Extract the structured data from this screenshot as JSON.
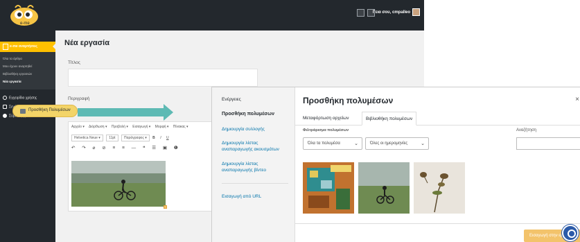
{
  "header": {
    "user_text": "Γεια σου, cmpalleo",
    "buttons": [
      "expand",
      "minimize"
    ]
  },
  "sidebar": {
    "active_section": "e-me αναρτήσεις",
    "sub_items": [
      "Όλα τα άρθρα",
      "Μου έχουν αναρτηθεί",
      "Βιβλιοθήκη εργασιών",
      "Νέα εργασία"
    ],
    "items": [
      "Εγχειρίδιο χρήσης",
      "Σενάρια χρήσης",
      "Σύμπτυξη μενού"
    ]
  },
  "editor": {
    "page_title": "Νέα εργασία",
    "title_label": "Τίτλος",
    "description_label": "Περιγραφή",
    "add_media_label": "Προσθήκη Πολυμέσων",
    "menubar": [
      "Αρχείο ▾",
      "Διόρθωση ▾",
      "Προβολή ▾",
      "Εισαγωγή ▾",
      "Μορφή ▾",
      "Πίνακας ▾"
    ],
    "font_family": "Helvetica Neue ▾",
    "font_size": "11pt",
    "paragraph": "Παράγραφος ▾",
    "bold": "B",
    "italic": "I",
    "underline": "U",
    "toolbar2": "↶ ↷ ⌀ ⊘ ≡ ≡ — ❝ ☰ ▣ ❶"
  },
  "media_modal": {
    "menu_heading": "Ενέργειες",
    "menu_current": "Προσθήκη πολυμέσων",
    "menu_links": [
      "Δημιουργία συλλογής",
      "Δημιουργία λίστας αναπαραγωγής ακουσμάτων",
      "Δημιουργία λίστας αναπαραγωγής βίντεο",
      "Εισαγωγή από URL"
    ],
    "title": "Προσθήκη πολυμέσων",
    "close": "×",
    "tabs": [
      "Μεταφόρτωση αρχείων",
      "Βιβλιοθήκη πολυμέσων"
    ],
    "filter_label": "Φιλτράρισμα πολυμέσων",
    "filter_type": "Όλα τα πολυμέσα",
    "filter_date": "Όλες οι ημερομηνίες",
    "search_label": "Αναζήτηση",
    "insert_button": "Εισαγωγή στην εργασία"
  },
  "colors": {
    "topbar": "#23282d",
    "accent_yellow": "#ffc000",
    "arrow_teal": "#5ebab4",
    "link_blue": "#0073aa"
  }
}
